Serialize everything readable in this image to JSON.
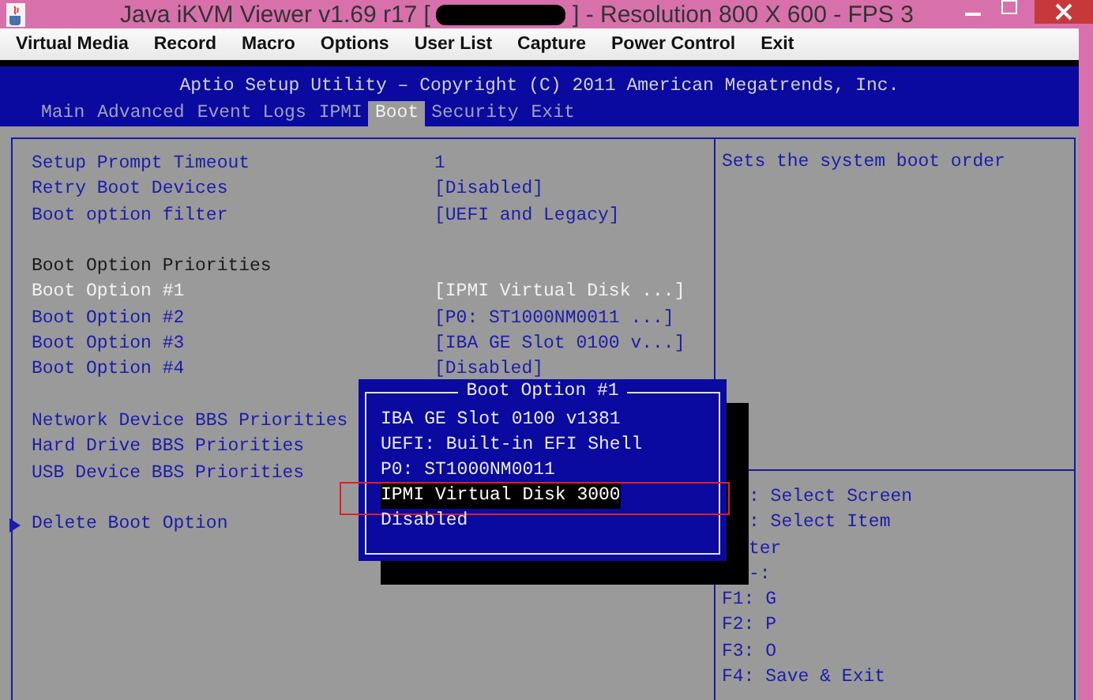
{
  "window": {
    "title_start": "Java iKVM Viewer v1.69 r17 [",
    "title_end": "] - Resolution 800 X 600 - FPS 3"
  },
  "menu": [
    "Virtual Media",
    "Record",
    "Macro",
    "Options",
    "User List",
    "Capture",
    "Power Control",
    "Exit"
  ],
  "bios": {
    "title": "Aptio Setup Utility – Copyright (C) 2011 American Megatrends, Inc.",
    "tabs": [
      {
        "label": "Main",
        "selected": false
      },
      {
        "label": "Advanced",
        "selected": false
      },
      {
        "label": "Event Logs",
        "selected": false
      },
      {
        "label": "IPMI",
        "selected": false
      },
      {
        "label": "Boot",
        "selected": true
      },
      {
        "label": "Security",
        "selected": false
      },
      {
        "label": "Exit",
        "selected": false
      }
    ],
    "settings": [
      {
        "kind": "item",
        "label": "Setup Prompt Timeout",
        "value": "1",
        "selected": false
      },
      {
        "kind": "item",
        "label": "Retry Boot Devices",
        "value": "[Disabled]",
        "selected": false
      },
      {
        "kind": "item",
        "label": "Boot option filter",
        "value": "[UEFI and Legacy]",
        "selected": false
      },
      {
        "kind": "gap"
      },
      {
        "kind": "heading",
        "label": "Boot Option Priorities"
      },
      {
        "kind": "item",
        "label": "Boot Option #1",
        "value": "[IPMI Virtual Disk ...]",
        "selected": true
      },
      {
        "kind": "item",
        "label": "Boot Option #2",
        "value": "[P0: ST1000NM0011  ...]",
        "selected": false
      },
      {
        "kind": "item",
        "label": "Boot Option #3",
        "value": "[IBA GE Slot 0100 v...]",
        "selected": false
      },
      {
        "kind": "item",
        "label": "Boot Option #4",
        "value": "[Disabled]",
        "selected": false
      },
      {
        "kind": "gap"
      },
      {
        "kind": "item",
        "label": "Network Device BBS Priorities",
        "selected": false
      },
      {
        "kind": "item",
        "label": "Hard Drive BBS Priorities",
        "selected": false
      },
      {
        "kind": "item",
        "label": "USB Device BBS Priorities",
        "selected": false
      },
      {
        "kind": "gap"
      },
      {
        "kind": "submenu",
        "label": "Delete Boot Option",
        "selected": false
      }
    ],
    "help_text": "Sets the system boot order",
    "help_keys": [
      {
        "kind": "partial",
        "text": ": Select Screen"
      },
      {
        "kind": "partial",
        "text": ": Select Item"
      },
      {
        "kind": "partial",
        "text": "ter"
      },
      {
        "kind": "partial",
        "text": "-:"
      },
      {
        "kind": "full",
        "text": "F1: G"
      },
      {
        "kind": "full",
        "text": "F2: P"
      },
      {
        "kind": "full",
        "text": "F3: O"
      },
      {
        "kind": "full",
        "text": "F4: Save & Exit"
      }
    ]
  },
  "popup": {
    "title": "Boot Option #1",
    "options": [
      {
        "label": "IBA GE Slot 0100 v1381",
        "selected": false,
        "marked": false
      },
      {
        "label": "UEFI: Built-in EFI Shell",
        "selected": false,
        "marked": false
      },
      {
        "label": "P0: ST1000NM0011",
        "selected": false,
        "marked": false
      },
      {
        "label": "IPMI Virtual Disk 3000",
        "selected": true,
        "marked": true
      },
      {
        "label": "Disabled",
        "selected": false,
        "marked": false
      }
    ]
  }
}
